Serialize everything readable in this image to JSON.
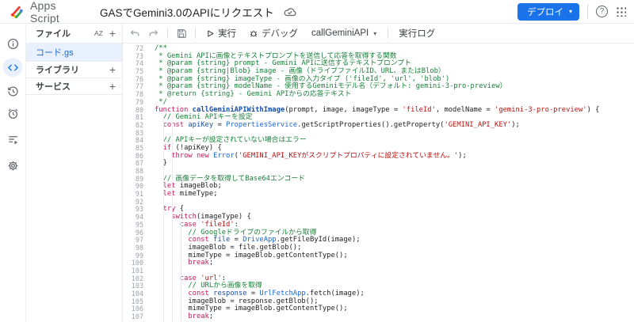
{
  "header": {
    "logo_label": "Apps Script",
    "title": "GASでGemini3.0のAPIにリクエスト",
    "deploy_label": "デプロイ",
    "deploy_caret": "▾",
    "help_glyph": "?"
  },
  "rail": {
    "items": [
      "overview",
      "editor",
      "project-history",
      "triggers",
      "executions",
      "settings"
    ],
    "selected": "editor"
  },
  "files_panel": {
    "title": "ファイル",
    "sort_icon": "AZ",
    "add_icon": "+",
    "files": [
      {
        "name": "コード.gs",
        "selected": true
      }
    ],
    "libraries_title": "ライブラリ",
    "services_title": "サービス"
  },
  "toolbar": {
    "run_label": "実行",
    "debug_label": "デバッグ",
    "function_selector": "callGeminiAPI",
    "function_caret": "▾",
    "log_label": "実行ログ"
  },
  "colors": {
    "accent": "#1a73e8",
    "selected_bg": "#e8f0fe",
    "selected_text": "#1967d2",
    "comment": "#188038",
    "keyword": "#c2185b",
    "string": "#b31412",
    "builtin": "#1967d2",
    "line_number": "#9aa0a6"
  },
  "code": {
    "lines": [
      {
        "n": 72,
        "t": [
          [
            "c",
            "/**"
          ]
        ]
      },
      {
        "n": 73,
        "t": [
          [
            "c",
            " * Gemini APIに画像とテキストプロンプトを送信して応答を取得する関数"
          ]
        ]
      },
      {
        "n": 74,
        "t": [
          [
            "c",
            " * @param {string} prompt - Gemini APIに送信するテキストプロンプト"
          ]
        ]
      },
      {
        "n": 75,
        "t": [
          [
            "c",
            " * @param {string|Blob} image - 画像（ドライブファイルID、URL、またはBlob）"
          ]
        ]
      },
      {
        "n": 76,
        "t": [
          [
            "c",
            " * @param {string} imageType - 画像の入力タイプ ('fileId', 'url', 'blob')"
          ]
        ]
      },
      {
        "n": 77,
        "t": [
          [
            "c",
            " * @param {string} modelName - 使用するGeminiモデル名（デフォルト: gemini-3-pro-preview）"
          ]
        ]
      },
      {
        "n": 78,
        "t": [
          [
            "c",
            " * @return {string} - Gemini APIからの応答テキスト"
          ]
        ]
      },
      {
        "n": 79,
        "t": [
          [
            "c",
            " */"
          ]
        ]
      },
      {
        "n": 80,
        "t": [
          [
            "k",
            "function"
          ],
          [
            "p",
            " "
          ],
          [
            "f",
            "callGeminiAPIWithImage"
          ],
          [
            "p",
            "(prompt, image, imageType = "
          ],
          [
            "s",
            "'fileId'"
          ],
          [
            "p",
            ", modelName = "
          ],
          [
            "s",
            "'gemini-3-pro-preview'"
          ],
          [
            "p",
            ") {"
          ]
        ]
      },
      {
        "n": 81,
        "t": [
          [
            "p",
            "  "
          ],
          [
            "c",
            "// Gemini APIキーを設定"
          ]
        ]
      },
      {
        "n": 82,
        "t": [
          [
            "p",
            "  "
          ],
          [
            "k",
            "const"
          ],
          [
            "p",
            " "
          ],
          [
            "v",
            "apiKey"
          ],
          [
            "p",
            " = "
          ],
          [
            "b",
            "PropertiesService"
          ],
          [
            "p",
            ".getScriptProperties().getProperty("
          ],
          [
            "s",
            "'GEMINI_API_KEY'"
          ],
          [
            "p",
            ");"
          ]
        ]
      },
      {
        "n": 83,
        "t": []
      },
      {
        "n": 84,
        "t": [
          [
            "p",
            "  "
          ],
          [
            "c",
            "// APIキーが設定されていない場合はエラー"
          ]
        ]
      },
      {
        "n": 85,
        "t": [
          [
            "p",
            "  "
          ],
          [
            "k",
            "if"
          ],
          [
            "p",
            " (!apiKey) {"
          ]
        ]
      },
      {
        "n": 86,
        "t": [
          [
            "p",
            "    "
          ],
          [
            "k",
            "throw"
          ],
          [
            "p",
            " "
          ],
          [
            "k",
            "new"
          ],
          [
            "p",
            " "
          ],
          [
            "b",
            "Error"
          ],
          [
            "p",
            "("
          ],
          [
            "s",
            "'GEMINI_API_KEYがスクリプトプロパティに設定されていません。'"
          ],
          [
            "p",
            ");"
          ]
        ]
      },
      {
        "n": 87,
        "t": [
          [
            "p",
            "  }"
          ]
        ]
      },
      {
        "n": 88,
        "t": []
      },
      {
        "n": 89,
        "t": [
          [
            "p",
            "  "
          ],
          [
            "c",
            "// 画像データを取得してBase64エンコード"
          ]
        ]
      },
      {
        "n": 90,
        "t": [
          [
            "p",
            "  "
          ],
          [
            "k",
            "let"
          ],
          [
            "p",
            " imageBlob;"
          ]
        ]
      },
      {
        "n": 91,
        "t": [
          [
            "p",
            "  "
          ],
          [
            "k",
            "let"
          ],
          [
            "p",
            " mimeType;"
          ]
        ]
      },
      {
        "n": 92,
        "t": []
      },
      {
        "n": 93,
        "t": [
          [
            "p",
            "  "
          ],
          [
            "k",
            "try"
          ],
          [
            "p",
            " {"
          ]
        ]
      },
      {
        "n": 94,
        "t": [
          [
            "p",
            "    "
          ],
          [
            "k",
            "switch"
          ],
          [
            "p",
            "(imageType) {"
          ]
        ]
      },
      {
        "n": 95,
        "t": [
          [
            "p",
            "      "
          ],
          [
            "k",
            "case"
          ],
          [
            "p",
            " "
          ],
          [
            "s",
            "'fileId'"
          ],
          [
            "p",
            ":"
          ]
        ]
      },
      {
        "n": 96,
        "t": [
          [
            "p",
            "        "
          ],
          [
            "c",
            "// Googleドライブのファイルから取得"
          ]
        ]
      },
      {
        "n": 97,
        "t": [
          [
            "p",
            "        "
          ],
          [
            "k",
            "const"
          ],
          [
            "p",
            " "
          ],
          [
            "v",
            "file"
          ],
          [
            "p",
            " = "
          ],
          [
            "b",
            "DriveApp"
          ],
          [
            "p",
            ".getFileById(image);"
          ]
        ]
      },
      {
        "n": 98,
        "t": [
          [
            "p",
            "        imageBlob = file.getBlob();"
          ]
        ]
      },
      {
        "n": 99,
        "t": [
          [
            "p",
            "        mimeType = imageBlob.getContentType();"
          ]
        ]
      },
      {
        "n": 100,
        "t": [
          [
            "p",
            "        "
          ],
          [
            "k",
            "break"
          ],
          [
            "p",
            ";"
          ]
        ]
      },
      {
        "n": 101,
        "t": []
      },
      {
        "n": 102,
        "t": [
          [
            "p",
            "      "
          ],
          [
            "k",
            "case"
          ],
          [
            "p",
            " "
          ],
          [
            "s",
            "'url'"
          ],
          [
            "p",
            ":"
          ]
        ]
      },
      {
        "n": 103,
        "t": [
          [
            "p",
            "        "
          ],
          [
            "c",
            "// URLから画像を取得"
          ]
        ]
      },
      {
        "n": 104,
        "t": [
          [
            "p",
            "        "
          ],
          [
            "k",
            "const"
          ],
          [
            "p",
            " "
          ],
          [
            "v",
            "response"
          ],
          [
            "p",
            " = "
          ],
          [
            "b",
            "UrlFetchApp"
          ],
          [
            "p",
            ".fetch(image);"
          ]
        ]
      },
      {
        "n": 105,
        "t": [
          [
            "p",
            "        imageBlob = response.getBlob();"
          ]
        ]
      },
      {
        "n": 106,
        "t": [
          [
            "p",
            "        mimeType = imageBlob.getContentType();"
          ]
        ]
      },
      {
        "n": 107,
        "t": [
          [
            "p",
            "        "
          ],
          [
            "k",
            "break"
          ],
          [
            "p",
            ";"
          ]
        ]
      }
    ]
  }
}
